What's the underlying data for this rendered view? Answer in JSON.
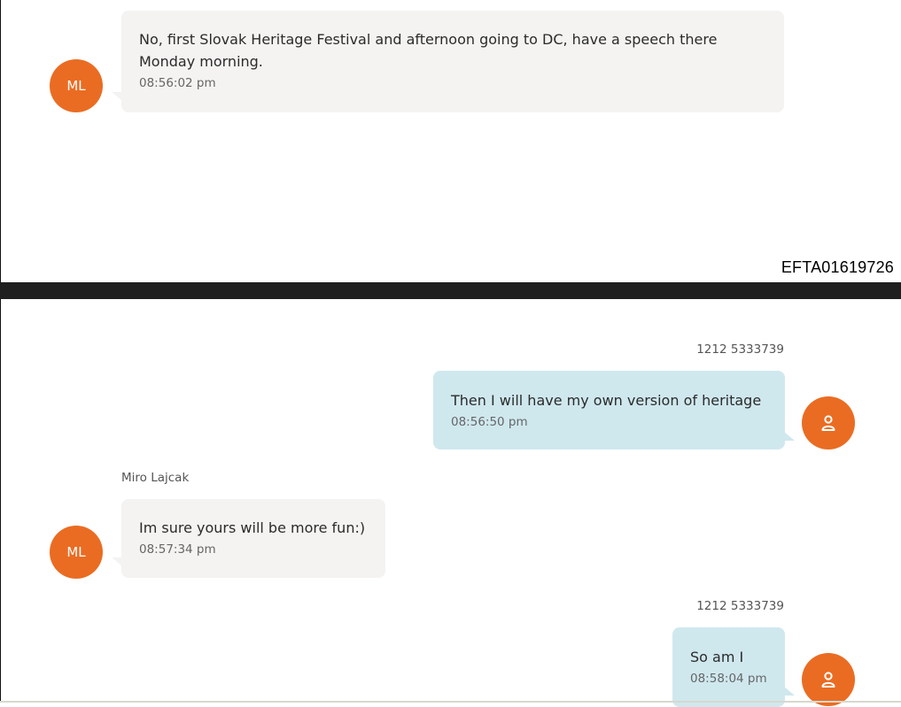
{
  "document_id": "EFTA01619726",
  "messages": [
    {
      "direction": "incoming",
      "sender": "",
      "avatar_initials": "ML",
      "text_line1": "No, first Slovak Heritage Festival and afternoon going to DC, have a speech there",
      "text_line2": "Monday morning.",
      "time": "08:56:02 pm"
    },
    {
      "direction": "outgoing",
      "sender": "1212 5333739",
      "avatar_icon": "person-icon",
      "text": "Then I will have my own version of heritage",
      "time": "08:56:50 pm"
    },
    {
      "direction": "incoming",
      "sender": "Miro Lajcak",
      "avatar_initials": "ML",
      "text": "Im sure yours will be more fun:)",
      "time": "08:57:34 pm"
    },
    {
      "direction": "outgoing",
      "sender": "1212 5333739",
      "avatar_icon": "person-icon",
      "text": "So am I",
      "time": "08:58:04 pm"
    }
  ],
  "colors": {
    "avatar": "#ea6c22",
    "incoming_bubble": "#f4f3f1",
    "outgoing_bubble": "#cfe8ee",
    "separator": "#1f1f1f"
  }
}
